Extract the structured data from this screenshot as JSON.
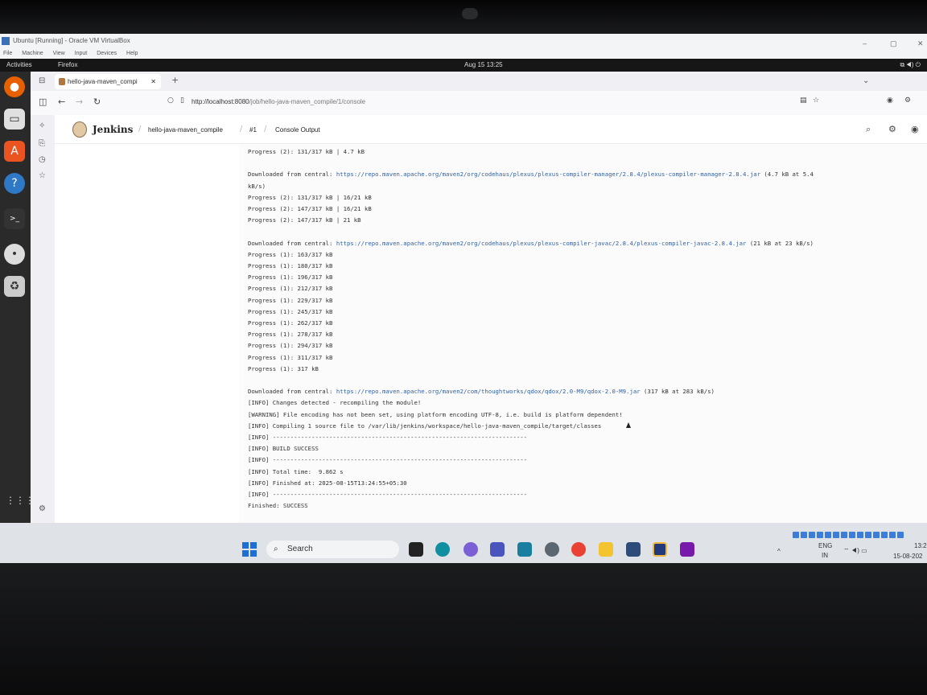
{
  "vbox": {
    "title": "Ubuntu [Running] - Oracle VM VirtualBox",
    "menu": [
      "File",
      "Machine",
      "View",
      "Input",
      "Devices",
      "Help"
    ]
  },
  "ubuntu": {
    "activities": "Activities",
    "app": "Firefox",
    "clock": "Aug 15  13:25"
  },
  "firefox": {
    "tab_title": "hello-java-maven_compi",
    "url_host": "http://localhost:8080",
    "url_path": "/job/hello-java-maven_compile/1/console"
  },
  "jenkins": {
    "brand": "Jenkins",
    "breadcrumbs": [
      "hello-java-maven_compile",
      "#1",
      "Console Output"
    ]
  },
  "console_lines": [
    {
      "text": "Progress (2): 131/317 kB | 4.7 kB"
    },
    {
      "text": ""
    },
    {
      "prefix": "Downloaded from central: ",
      "link": "https://repo.maven.apache.org/maven2/org/codehaus/plexus/plexus-compiler-manager/2.8.4/plexus-compiler-manager-2.8.4.jar",
      "suffix": " (4.7 kB at 5.4"
    },
    {
      "text": "kB/s)"
    },
    {
      "text": "Progress (2): 131/317 kB | 16/21 kB"
    },
    {
      "text": "Progress (2): 147/317 kB | 16/21 kB"
    },
    {
      "text": "Progress (2): 147/317 kB | 21 kB"
    },
    {
      "text": ""
    },
    {
      "prefix": "Downloaded from central: ",
      "link": "https://repo.maven.apache.org/maven2/org/codehaus/plexus/plexus-compiler-javac/2.8.4/plexus-compiler-javac-2.8.4.jar",
      "suffix": " (21 kB at 23 kB/s)"
    },
    {
      "text": "Progress (1): 163/317 kB"
    },
    {
      "text": "Progress (1): 180/317 kB"
    },
    {
      "text": "Progress (1): 196/317 kB"
    },
    {
      "text": "Progress (1): 212/317 kB"
    },
    {
      "text": "Progress (1): 229/317 kB"
    },
    {
      "text": "Progress (1): 245/317 kB"
    },
    {
      "text": "Progress (1): 262/317 kB"
    },
    {
      "text": "Progress (1): 278/317 kB"
    },
    {
      "text": "Progress (1): 294/317 kB"
    },
    {
      "text": "Progress (1): 311/317 kB"
    },
    {
      "text": "Progress (1): 317 kB"
    },
    {
      "text": ""
    },
    {
      "prefix": "Downloaded from central: ",
      "link": "https://repo.maven.apache.org/maven2/com/thoughtworks/qdox/qdox/2.0-M9/qdox-2.0-M9.jar",
      "suffix": " (317 kB at 283 kB/s)"
    },
    {
      "text": "[INFO] Changes detected - recompiling the module!"
    },
    {
      "text": "[WARNING] File encoding has not been set, using platform encoding UTF-8, i.e. build is platform dependent!"
    },
    {
      "text": "[INFO] Compiling 1 source file to /var/lib/jenkins/workspace/hello-java-maven_compile/target/classes"
    },
    {
      "text": "[INFO] ------------------------------------------------------------------------"
    },
    {
      "text": "[INFO] BUILD SUCCESS"
    },
    {
      "text": "[INFO] ------------------------------------------------------------------------"
    },
    {
      "text": "[INFO] Total time:  9.862 s"
    },
    {
      "text": "[INFO] Finished at: 2025-08-15T13:24:55+05:30"
    },
    {
      "text": "[INFO] ------------------------------------------------------------------------"
    },
    {
      "text": "Finished: SUCCESS"
    }
  ],
  "taskbar": {
    "search": "Search",
    "lang1": "ENG",
    "lang2": "IN",
    "time": "13:2",
    "date": "15-08-202"
  },
  "colors": {
    "link": "#2f5fa5",
    "dock": "#2a2a2a",
    "topbar": "#161616"
  }
}
